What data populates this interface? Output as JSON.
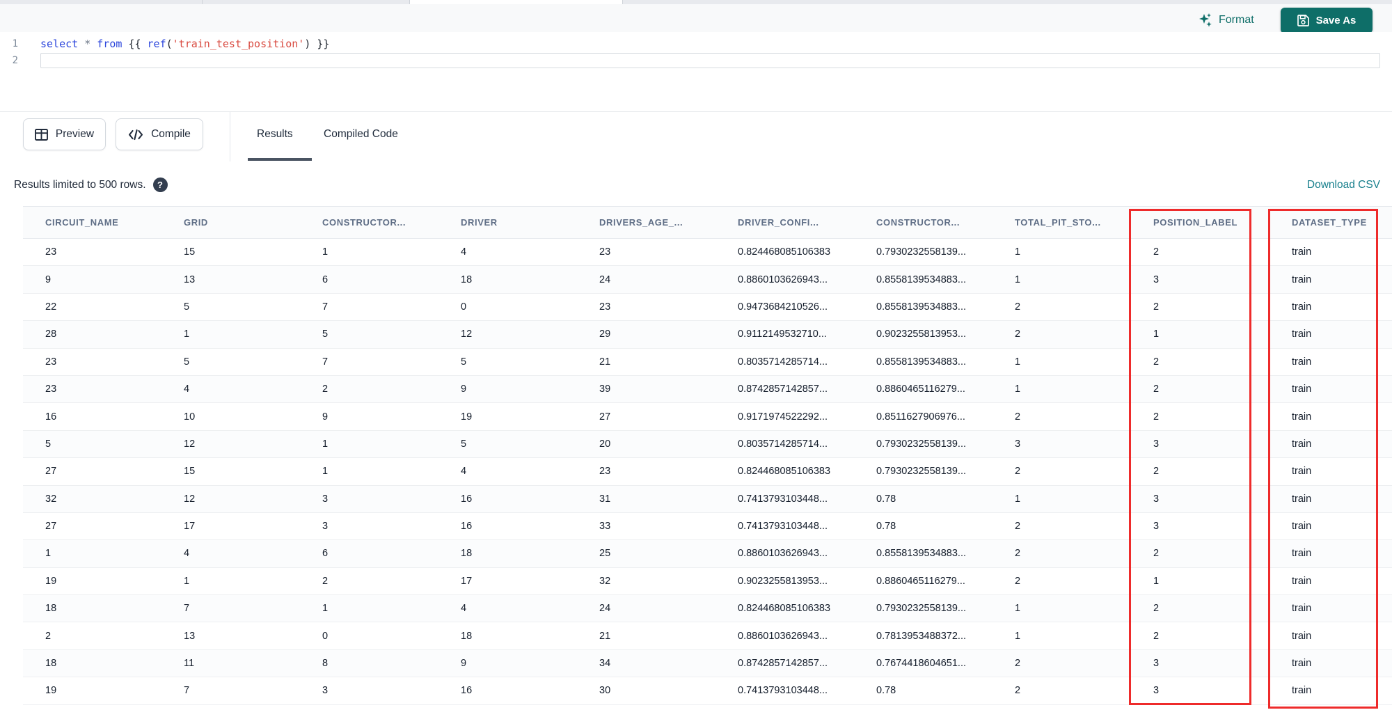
{
  "toolbar": {
    "format_label": "Format",
    "save_as_label": "Save As"
  },
  "editor": {
    "lines": [
      {
        "number": "1",
        "tokens": [
          {
            "text": "select",
            "type": "keyword"
          },
          {
            "text": " ",
            "type": "plain"
          },
          {
            "text": "*",
            "type": "operator"
          },
          {
            "text": " ",
            "type": "plain"
          },
          {
            "text": "from",
            "type": "keyword"
          },
          {
            "text": " {{ ",
            "type": "plain"
          },
          {
            "text": "ref",
            "type": "function"
          },
          {
            "text": "(",
            "type": "plain"
          },
          {
            "text": "'train_test_position'",
            "type": "string"
          },
          {
            "text": ")",
            "type": "plain"
          },
          {
            "text": " }}",
            "type": "plain"
          }
        ]
      },
      {
        "number": "2",
        "tokens": []
      }
    ]
  },
  "action_bar": {
    "preview_label": "Preview",
    "compile_label": "Compile"
  },
  "tabs": [
    {
      "label": "Results",
      "active": true
    },
    {
      "label": "Compiled Code",
      "active": false
    }
  ],
  "results_bar": {
    "limit_note": "Results limited to 500 rows.",
    "help_icon": "?",
    "download_link": "Download CSV"
  },
  "table": {
    "headers": [
      "CIRCUIT_NAME",
      "GRID",
      "CONSTRUCTOR...",
      "DRIVER",
      "DRIVERS_AGE_...",
      "DRIVER_CONFI...",
      "CONSTRUCTOR...",
      "TOTAL_PIT_STO...",
      "POSITION_LABEL",
      "DATASET_TYPE"
    ],
    "rows": [
      [
        "23",
        "15",
        "1",
        "4",
        "23",
        "0.824468085106383",
        "0.7930232558139...",
        "1",
        "2",
        "train"
      ],
      [
        "9",
        "13",
        "6",
        "18",
        "24",
        "0.8860103626943...",
        "0.8558139534883...",
        "1",
        "3",
        "train"
      ],
      [
        "22",
        "5",
        "7",
        "0",
        "23",
        "0.9473684210526...",
        "0.8558139534883...",
        "2",
        "2",
        "train"
      ],
      [
        "28",
        "1",
        "5",
        "12",
        "29",
        "0.9112149532710...",
        "0.9023255813953...",
        "2",
        "1",
        "train"
      ],
      [
        "23",
        "5",
        "7",
        "5",
        "21",
        "0.8035714285714...",
        "0.8558139534883...",
        "1",
        "2",
        "train"
      ],
      [
        "23",
        "4",
        "2",
        "9",
        "39",
        "0.8742857142857...",
        "0.8860465116279...",
        "1",
        "2",
        "train"
      ],
      [
        "16",
        "10",
        "9",
        "19",
        "27",
        "0.9171974522292...",
        "0.8511627906976...",
        "2",
        "2",
        "train"
      ],
      [
        "5",
        "12",
        "1",
        "5",
        "20",
        "0.8035714285714...",
        "0.7930232558139...",
        "3",
        "3",
        "train"
      ],
      [
        "27",
        "15",
        "1",
        "4",
        "23",
        "0.824468085106383",
        "0.7930232558139...",
        "2",
        "2",
        "train"
      ],
      [
        "32",
        "12",
        "3",
        "16",
        "31",
        "0.7413793103448...",
        "0.78",
        "1",
        "3",
        "train"
      ],
      [
        "27",
        "17",
        "3",
        "16",
        "33",
        "0.7413793103448...",
        "0.78",
        "2",
        "3",
        "train"
      ],
      [
        "1",
        "4",
        "6",
        "18",
        "25",
        "0.8860103626943...",
        "0.8558139534883...",
        "2",
        "2",
        "train"
      ],
      [
        "19",
        "1",
        "2",
        "17",
        "32",
        "0.9023255813953...",
        "0.8860465116279...",
        "2",
        "1",
        "train"
      ],
      [
        "18",
        "7",
        "1",
        "4",
        "24",
        "0.824468085106383",
        "0.7930232558139...",
        "1",
        "2",
        "train"
      ],
      [
        "2",
        "13",
        "0",
        "18",
        "21",
        "0.8860103626943...",
        "0.7813953488372...",
        "1",
        "2",
        "train"
      ],
      [
        "18",
        "11",
        "8",
        "9",
        "34",
        "0.8742857142857...",
        "0.7674418604651...",
        "2",
        "3",
        "train"
      ],
      [
        "19",
        "7",
        "3",
        "16",
        "30",
        "0.7413793103448...",
        "0.78",
        "2",
        "3",
        "train"
      ]
    ],
    "highlighted_columns": [
      "POSITION_LABEL",
      "DATASET_TYPE"
    ]
  },
  "colors": {
    "accent_teal": "#0e6e68",
    "link_teal": "#177f8c",
    "highlight_red": "#ee2b2b",
    "keyword_blue": "#2c46dc",
    "string_red": "#d94b41"
  }
}
